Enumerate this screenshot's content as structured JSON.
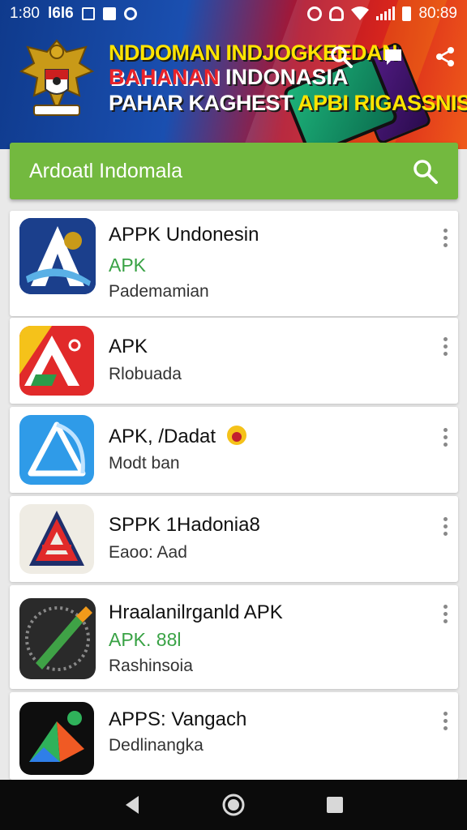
{
  "status_bar": {
    "time_left": "1:80",
    "carrier": "l6l6",
    "time_right": "80:89"
  },
  "banner": {
    "line1": "NDDOMAN INDJOGKEEDAN",
    "line2_red": "BAHANAN",
    "line2_white": "INDONASIA",
    "line3_white": "PAHAR KAGHEST",
    "line3_yellow": "APBI RIGASSNISU!!"
  },
  "search": {
    "query": "Ardoatl Indomala",
    "icon": "search-icon"
  },
  "apps": [
    {
      "title": "APPK Undonesin",
      "tag": "APK",
      "subtitle": "Pademamian"
    },
    {
      "title": "APK",
      "tag": "",
      "subtitle": "Rlobuada"
    },
    {
      "title": "APK, /Dadat",
      "tag": "",
      "subtitle": "Modt ban"
    },
    {
      "title": "SPPK 1Hadonia8",
      "tag": "",
      "subtitle": "Eaoo: Aad"
    },
    {
      "title": "Hraalanilrganld APK",
      "tag": "APK. 88l",
      "subtitle": "Rashinsoia"
    },
    {
      "title": "APPS: Vangach",
      "tag": "",
      "subtitle": "Dedlinangka"
    }
  ],
  "colors": {
    "accent_green": "#73b93f",
    "tag_green": "#39a245",
    "nav_bar": "#0b0b0b"
  }
}
